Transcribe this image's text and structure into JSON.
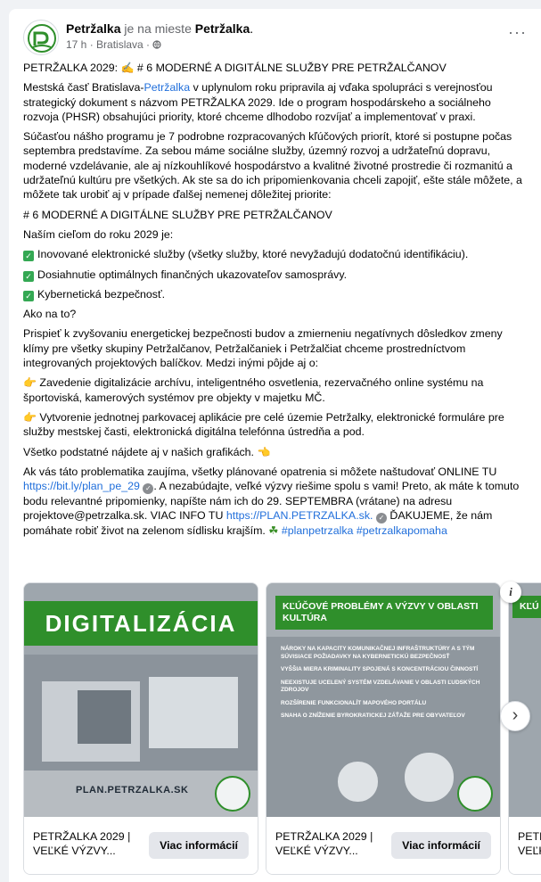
{
  "header": {
    "page_name": "Petržalka",
    "connector": " je na mieste ",
    "place": "Petržalka",
    "place_suffix": ".",
    "meta": "17 h · Bratislava · ",
    "more_glyph": "···"
  },
  "post": {
    "title_pre": "PETRŽALKA 2029: ",
    "title_post": " # 6 MODERNÉ A DIGITÁLNE SLUŽBY PRE PETRŽALČANOV",
    "p1_a": "Mestská časť Bratislava-",
    "p1_link": "Petržalka",
    "p1_b": " v uplynulom roku pripravila aj vďaka spolupráci s verejnosťou strategický dokument s názvom PETRŽALKA 2029. Ide o program hospodárskeho a sociálneho rozvoja (PHSR) obsahujúci priority, ktoré chceme dlhodobo rozvíjať a implementovať v praxi.",
    "p2": "Súčasťou nášho programu je 7 podrobne rozpracovaných kľúčových priorít, ktoré si postupne počas septembra predstavíme. Za sebou máme sociálne služby, územný rozvoj a udržateľnú dopravu, moderné vzdelávanie, ale aj nízkouhlíkové hospodárstvo a kvalitné životné prostredie či rozmanitú a udržateľnú kultúru pre všetkých. Ak ste sa do ich pripomienkovania chceli zapojiť, ešte stále môžete, a môžete tak urobiť aj v prípade ďalšej nemenej dôležitej priorite:",
    "p3": "# 6 MODERNÉ A DIGITÁLNE SLUŽBY PRE PETRŽALČANOV",
    "p4": "Naším cieľom do roku 2029 je:",
    "goals": [
      "Inovované elektronické služby (všetky služby, ktoré nevyžadujú dodatočnú identifikáciu).",
      "Dosiahnutie optimálnych finančných ukazovateľov samosprávy.",
      "Kybernetická bezpečnosť."
    ],
    "p5": "Ako na to?",
    "p6": "Prispieť k zvyšovaniu energetickej bezpečnosti budov a zmierneniu negatívnych dôsledkov zmeny klímy pre všetky skupiny Petržalčanov, Petržalčaniek i Petržalčiat chceme prostredníctvom integrovaných projektových balíčkov. Medzi inými pôjde aj o:",
    "bullets": [
      "Zavedenie digitalizácie archívu, inteligentného osvetlenia, rezervačného online systému na športoviská, kamerových systémov pre objekty v majetku MČ.",
      "Vytvorenie jednotnej parkovacej aplikácie pre celé územie Petržalky, elektronické formuláre pre služby mestskej časti, elektronická digitálna telefónna ústredňa a pod."
    ],
    "p7": "Všetko podstatné nájdete aj v našich grafikách. ",
    "p8_a": "Ak vás táto problematika zaujíma, všetky plánované opatrenia si môžete naštudovať ONLINE TU ",
    "p8_link1": "https://bit.ly/plan_pe_29",
    "p8_b": ". A nezabúdajte, veľké výzvy riešime spolu s vami! Preto, ak máte k tomuto bodu relevantné pripomienky, napíšte nám ich do 29. SEPTEMBRA (vrátane) na adresu projektove@petrzalka.sk. VIAC INFO TU ",
    "p8_link2": "https://PLAN.PETRZALKA.sk.",
    "p8_c": " ĎAKUJEME, že nám pomáhate robiť život na zelenom sídlisku krajším. ",
    "p8_tags": "#planpetrzalka #petrzalkapomaha"
  },
  "carousel": {
    "items": [
      {
        "banner": "DIGITALIZÁCIA",
        "url": "PLAN.PETRZALKA.SK",
        "title": "PETRŽALKA 2029 | VEĽKÉ VÝZVY...",
        "button": "Viac informácií"
      },
      {
        "heading": "KĽÚČOVÉ PROBLÉMY A VÝZVY V OBLASTI KULTÚRA",
        "list": [
          "NÁROKY NA KAPACITY KOMUNIKAČNEJ INFRAŠTRUKTÚRY A S TÝM SÚVISIACE POŽIADAVKY NA KYBERNETICKÚ BEZPEČNOSŤ",
          "VYŠŠIA MIERA KRIMINALITY SPOJENÁ S KONCENTRÁCIOU ČINNOSTÍ",
          "NEEXISTUJE UCELENÝ SYSTÉM VZDELÁVANIE V OBLASTI ĽUDSKÝCH ZDROJOV",
          "ROZŠÍRENIE FUNKCIONALÍT MAPOVÉHO PORTÁLU",
          "SNAHA O ZNÍŽENIE BYROKRATICKEJ ZÁŤAŽE PRE OBYVATEĽOV"
        ],
        "title": "PETRŽALKA 2029 | VEĽKÉ VÝZVY...",
        "button": "Viac informácií"
      },
      {
        "heading": "KĽÚ",
        "title": "PETR VEĽK"
      }
    ],
    "next_glyph": "›",
    "info_glyph": "i"
  }
}
